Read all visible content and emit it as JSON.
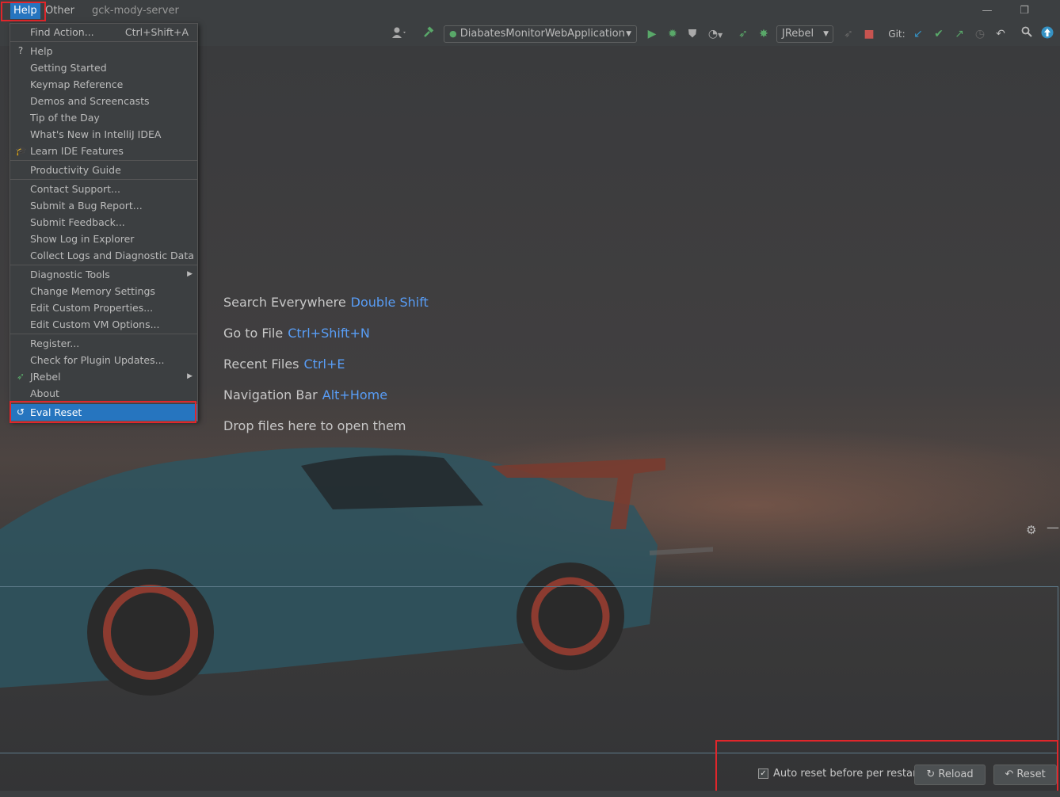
{
  "titlebar": {
    "menu_help": "Help",
    "menu_other": "Other",
    "project": "gck-mody-server",
    "minimize_glyph": "—",
    "restore_glyph": "❐"
  },
  "toolbar": {
    "run_config": "DiabatesMonitorWebApplication",
    "jrebel_combo": "JRebel",
    "git_label": "Git:"
  },
  "help_menu": {
    "find_action": "Find Action...",
    "find_action_shortcut": "Ctrl+Shift+A",
    "help": "Help",
    "getting_started": "Getting Started",
    "keymap_reference": "Keymap Reference",
    "demos": "Demos and Screencasts",
    "tip": "Tip of the Day",
    "whats_new": "What's New in IntelliJ IDEA",
    "learn": "Learn IDE Features",
    "productivity": "Productivity Guide",
    "contact": "Contact Support...",
    "bug": "Submit a Bug Report...",
    "feedback": "Submit Feedback...",
    "show_log": "Show Log in Explorer",
    "collect_logs": "Collect Logs and Diagnostic Data",
    "diagnostic_tools": "Diagnostic Tools",
    "memory": "Change Memory Settings",
    "custom_props": "Edit Custom Properties...",
    "custom_vm": "Edit Custom VM Options...",
    "register": "Register...",
    "plugin_updates": "Check for Plugin Updates...",
    "jrebel": "JRebel",
    "about": "About",
    "eval_reset": "Eval Reset"
  },
  "hints": {
    "search_label": "Search Everywhere",
    "search_key": "Double Shift",
    "goto_label": "Go to File",
    "goto_key": "Ctrl+Shift+N",
    "recent_label": "Recent Files",
    "recent_key": "Ctrl+E",
    "nav_label": "Navigation Bar",
    "nav_key": "Alt+Home",
    "drop": "Drop files here to open them"
  },
  "eval_panel": {
    "auto_reset_label": "Auto reset before per restart",
    "auto_reset_checked": true,
    "reload": "Reload",
    "reset": "Reset"
  },
  "colors": {
    "accent": "#2675bf",
    "highlight_outline": "#e0262b",
    "shortcut_text": "#589df6"
  }
}
